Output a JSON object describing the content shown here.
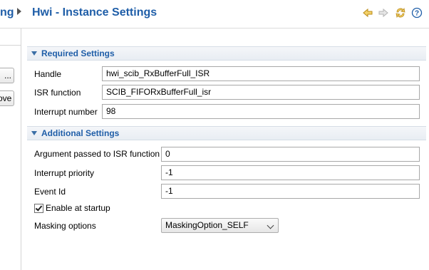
{
  "header": {
    "breadcrumb_prev": "ng",
    "title": "Hwi - Instance Settings",
    "toolbar": [
      {
        "name": "back-arrow-icon",
        "color": "#e5b53b"
      },
      {
        "name": "forward-arrow-icon",
        "color": "#c7c7c7"
      },
      {
        "name": "sync-icon",
        "color": "#e5b53b"
      },
      {
        "name": "help-icon",
        "color": "#1f5ea8"
      }
    ]
  },
  "left_panel": {
    "buttons": [
      "...",
      "ove"
    ]
  },
  "required_settings": {
    "title": "Required Settings",
    "handle_label": "Handle",
    "handle_value": "hwi_scib_RxBufferFull_ISR",
    "isr_label": "ISR function",
    "isr_value": "SCIB_FIFORxBufferFull_isr",
    "interrupt_number_label": "Interrupt number",
    "interrupt_number_value": "98"
  },
  "additional_settings": {
    "title": "Additional Settings",
    "arg_label": "Argument passed to ISR function",
    "arg_value": "0",
    "priority_label": "Interrupt priority",
    "priority_value": "-1",
    "event_label": "Event Id",
    "event_value": "-1",
    "enable_label": "Enable at startup",
    "enable_checked": true,
    "masking_label": "Masking options",
    "masking_value": "MaskingOption_SELF"
  },
  "colors": {
    "accent": "#1f5ea8",
    "section_bg": "#e8edf3"
  }
}
